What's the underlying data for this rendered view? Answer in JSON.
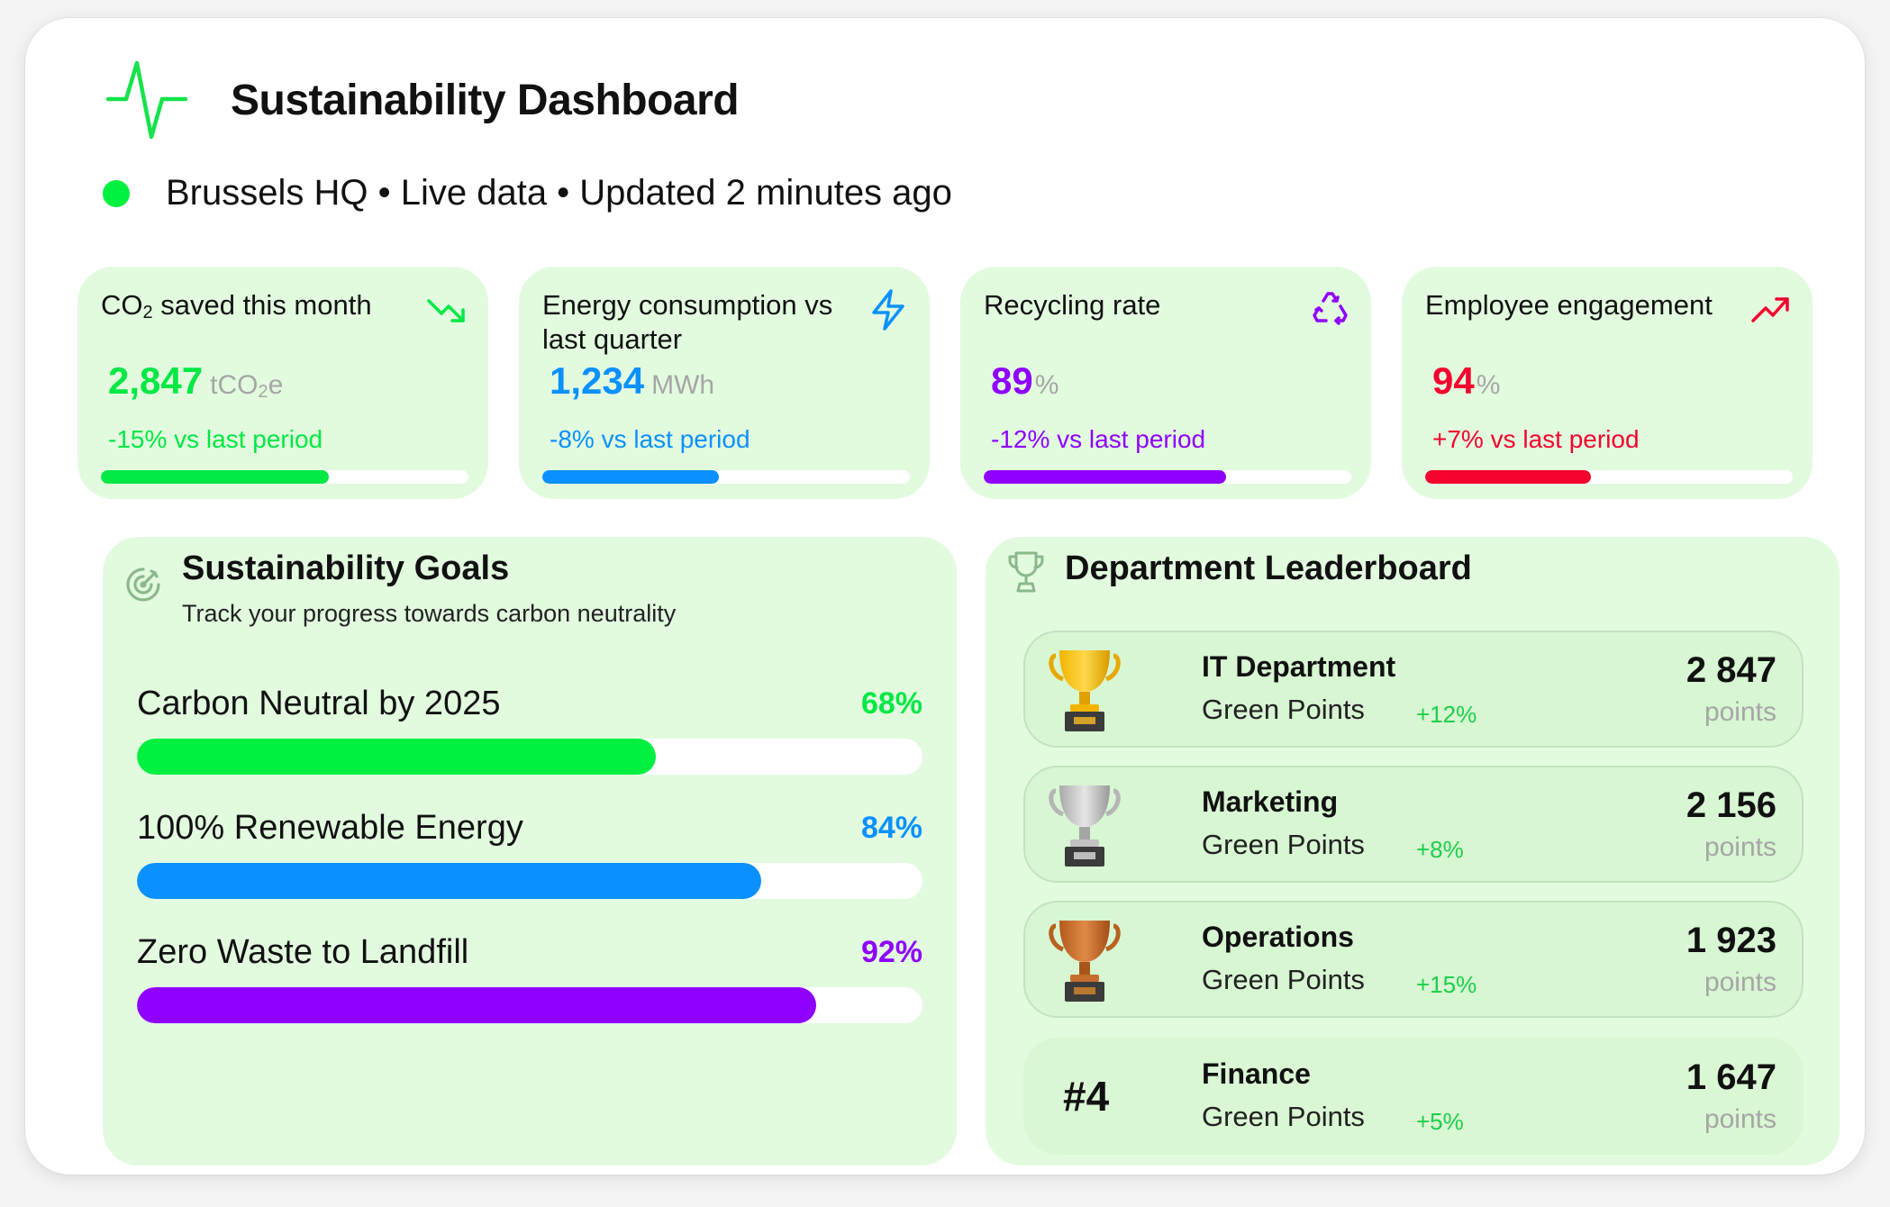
{
  "header": {
    "title": "Sustainability Dashboard",
    "status": "Brussels HQ • Live data • Updated 2 minutes ago",
    "status_color": "#00f040"
  },
  "metrics": [
    {
      "label": "CO₂ saved this month",
      "value": "2,847",
      "unit": "tCO₂e",
      "change": "-15% vs last period",
      "color": "#00e844",
      "progress": 0.62,
      "icon": "trend-down-icon"
    },
    {
      "label": "Energy consumption vs last quarter",
      "value": "1,234",
      "unit": "MWh",
      "change": "-8% vs last period",
      "color": "#0b91ff",
      "progress": 0.48,
      "icon": "lightning-icon"
    },
    {
      "label": "Recycling rate",
      "value": "89",
      "unit": "%",
      "change": "-12% vs last period",
      "color": "#8f00ff",
      "progress": 0.66,
      "icon": "recycle-icon"
    },
    {
      "label": "Employee engagement",
      "value": "94",
      "unit": "%",
      "change": "+7% vs last period",
      "color": "#f5022e",
      "progress": 0.45,
      "icon": "trend-up-icon"
    }
  ],
  "goals": {
    "title": "Sustainability Goals",
    "subtitle": "Track your progress towards carbon neutrality",
    "items": [
      {
        "label": "Carbon Neutral by 2025",
        "percent_text": "68%",
        "progress": 0.66,
        "color": "#00f040"
      },
      {
        "label": "100% Renewable Energy",
        "percent_text": "84%",
        "progress": 0.795,
        "color": "#0b91ff"
      },
      {
        "label": "Zero Waste to Landfill",
        "percent_text": "92%",
        "progress": 0.865,
        "color": "#8f00ff"
      }
    ]
  },
  "leaderboard": {
    "title": "Department Leaderboard",
    "rows": [
      {
        "rank": "1",
        "trophy": "gold-trophy-icon",
        "name": "IT Department",
        "subtitle": "Green Points",
        "change": "+12%",
        "points": "2 847",
        "unit": "points"
      },
      {
        "rank": "2",
        "trophy": "silver-trophy-icon",
        "name": "Marketing",
        "subtitle": "Green Points",
        "change": "+8%",
        "points": "2 156",
        "unit": "points"
      },
      {
        "rank": "3",
        "trophy": "bronze-trophy-icon",
        "name": "Operations",
        "subtitle": "Green Points",
        "change": "+15%",
        "points": "1 923",
        "unit": "points"
      },
      {
        "rank": "#4",
        "trophy": "",
        "name": "Finance",
        "subtitle": "Green Points",
        "change": "+5%",
        "points": "1 647",
        "unit": "points"
      }
    ]
  }
}
